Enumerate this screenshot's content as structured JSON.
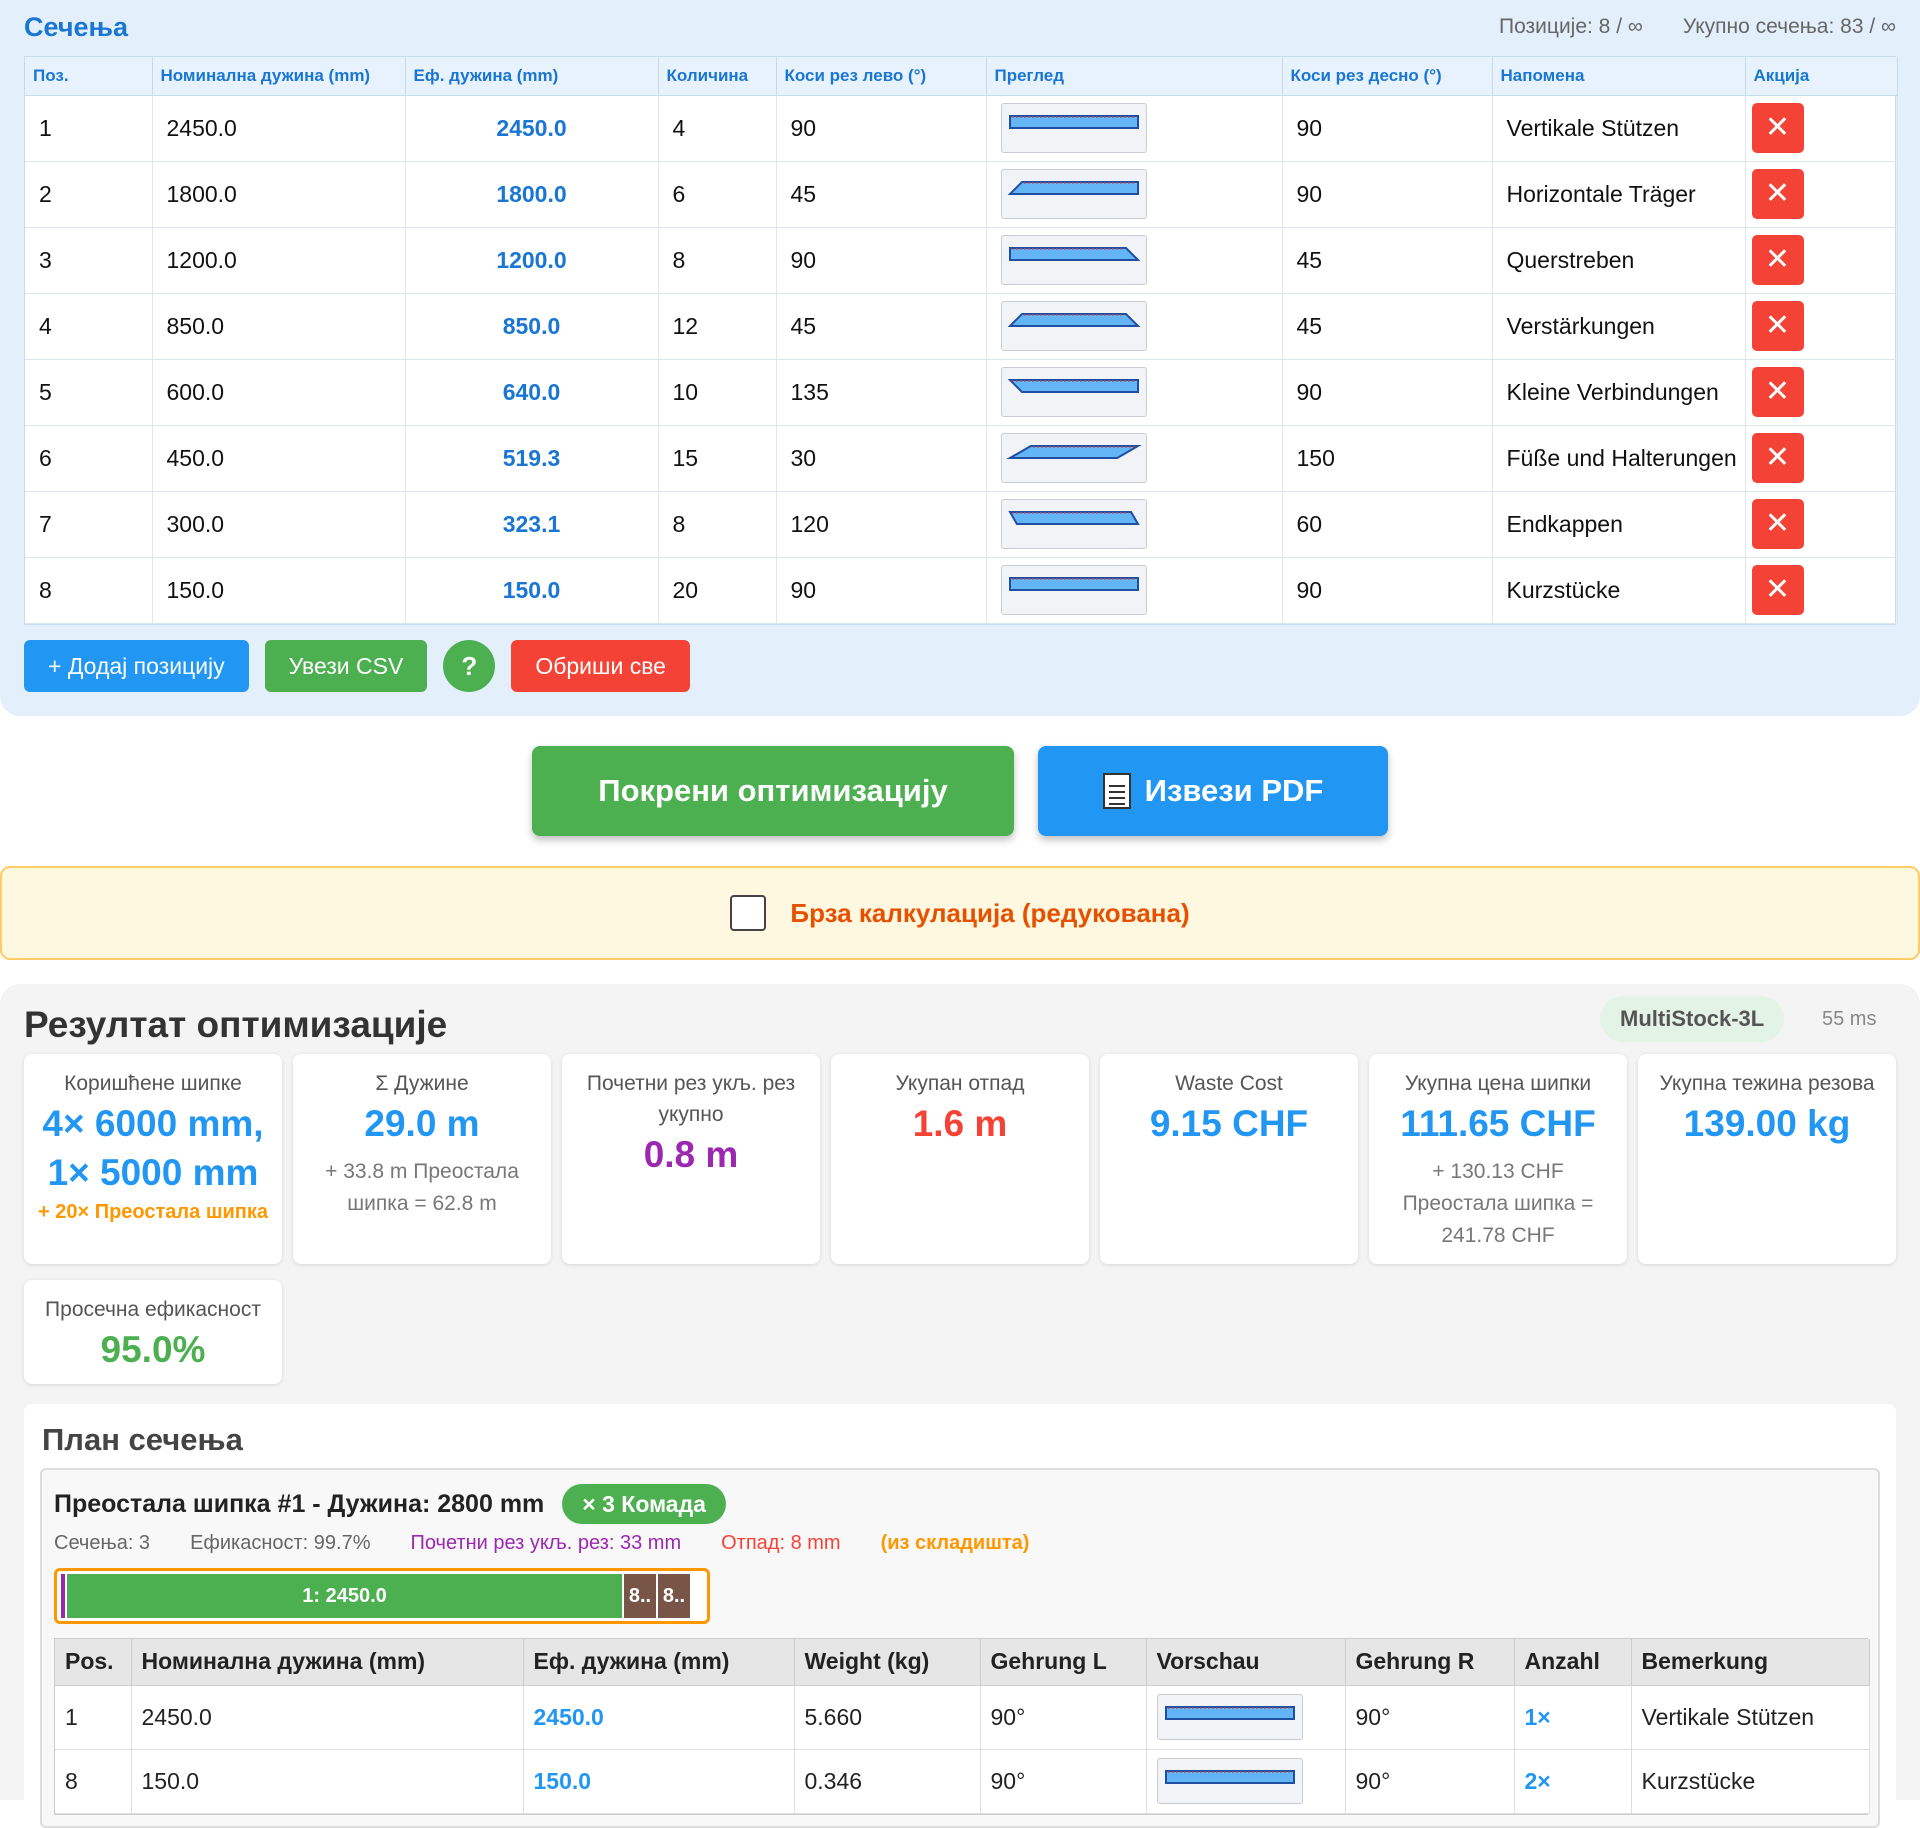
{
  "cuts": {
    "title": "Сечења",
    "stat_positions": "Позиције: 8 / ∞",
    "stat_total": "Укупно сечења: 83 / ∞",
    "headers": [
      "Поз.",
      "Номинална дужина (mm)",
      "Еф. дужина (mm)",
      "Количина",
      "Коси рез лево (°)",
      "Преглед",
      "Коси рез десно (°)",
      "Напомена",
      "Акција"
    ],
    "rows": [
      {
        "pos": "1",
        "nominal": "2450.0",
        "effective": "2450.0",
        "qty": "4",
        "left": "90",
        "right": "90",
        "note": "Vertikale Stützen"
      },
      {
        "pos": "2",
        "nominal": "1800.0",
        "effective": "1800.0",
        "qty": "6",
        "left": "45",
        "right": "90",
        "note": "Horizontale Träger"
      },
      {
        "pos": "3",
        "nominal": "1200.0",
        "effective": "1200.0",
        "qty": "8",
        "left": "90",
        "right": "45",
        "note": "Querstreben"
      },
      {
        "pos": "4",
        "nominal": "850.0",
        "effective": "850.0",
        "qty": "12",
        "left": "45",
        "right": "45",
        "note": "Verstärkungen"
      },
      {
        "pos": "5",
        "nominal": "600.0",
        "effective": "640.0",
        "qty": "10",
        "left": "135",
        "right": "90",
        "note": "Kleine Verbindungen"
      },
      {
        "pos": "6",
        "nominal": "450.0",
        "effective": "519.3",
        "qty": "15",
        "left": "30",
        "right": "150",
        "note": "Füße und Halterungen"
      },
      {
        "pos": "7",
        "nominal": "300.0",
        "effective": "323.1",
        "qty": "8",
        "left": "120",
        "right": "60",
        "note": "Endkappen"
      },
      {
        "pos": "8",
        "nominal": "150.0",
        "effective": "150.0",
        "qty": "20",
        "left": "90",
        "right": "90",
        "note": "Kurzstücke"
      }
    ],
    "delete_symbol": "✕",
    "add_label": "+ Додај позицију",
    "import_label": "Увези CSV",
    "help_label": "?",
    "clear_label": "Обриши све"
  },
  "actions": {
    "run_label": "Покрени оптимизацију",
    "pdf_label": "Извези PDF",
    "pdf_icon": "document-icon"
  },
  "quick": {
    "label": "Брза калкулација (редукована)",
    "checked": false
  },
  "results": {
    "title": "Резултат оптимизације",
    "algorithm": "MultiStock-3L",
    "time": "55 ms",
    "cards": {
      "bars_label": "Коришћене шипке",
      "bars_value_1": "4× 6000 mm,",
      "bars_value_2": "1× 5000 mm",
      "bars_extra": "+ 20× Преостала шипка",
      "lengths_label": "Σ Дужине",
      "lengths_value": "29.0 m",
      "lengths_sub": "+ 33.8 m Преостала шипка = 62.8 m",
      "kerf_label": "Почетни рез укљ. рез укупно",
      "kerf_value": "0.8 m",
      "waste_label": "Укупан отпад",
      "waste_value": "1.6 m",
      "waste_cost_label": "Waste Cost",
      "waste_cost_value": "9.15 CHF",
      "price_label": "Укупна цена шипки",
      "price_value": "111.65 CHF",
      "price_sub": "+ 130.13 CHF Преостала шипка = 241.78 CHF",
      "weight_label": "Укупна тежина резова",
      "weight_value": "139.00 kg",
      "eff_label": "Просечна ефикасност",
      "eff_value": "95.0%"
    },
    "colors": {
      "blue": "#2196f3",
      "purple": "#9c27b0",
      "red": "#f44336",
      "green": "#4caf50",
      "orange": "#ff9800"
    }
  },
  "plan": {
    "title": "План сечења",
    "bar_name": "Преостала шипка #1 - Дужина: 2800 mm",
    "bar_qty": "× 3 Комада",
    "meta_cuts": "Сечења: 3",
    "meta_eff": "Ефикасност: 99.7%",
    "meta_kerf": "Почетни рез укљ. рез: 33 mm",
    "meta_waste": "Отпад: 8 mm",
    "meta_stock": "(из складишта)",
    "bar_stock_length": 2800,
    "segments": [
      {
        "label": "1: 2450.0",
        "length": 2450
      },
      {
        "label": "8..",
        "length": 150
      },
      {
        "label": "8..",
        "length": 150
      }
    ],
    "headers": [
      "Pos.",
      "Номинална дужина (mm)",
      "Еф. дужина (mm)",
      "Weight (kg)",
      "Gehrung L",
      "Vorschau",
      "Gehrung R",
      "Anzahl",
      "Bemerkung"
    ],
    "rows": [
      {
        "pos": "1",
        "nominal": "2450.0",
        "effective": "2450.0",
        "weight": "5.660",
        "left": "90°",
        "right": "90°",
        "count": "1×",
        "note": "Vertikale Stützen"
      },
      {
        "pos": "8",
        "nominal": "150.0",
        "effective": "150.0",
        "weight": "0.346",
        "left": "90°",
        "right": "90°",
        "count": "2×",
        "note": "Kurzstücke"
      }
    ]
  }
}
